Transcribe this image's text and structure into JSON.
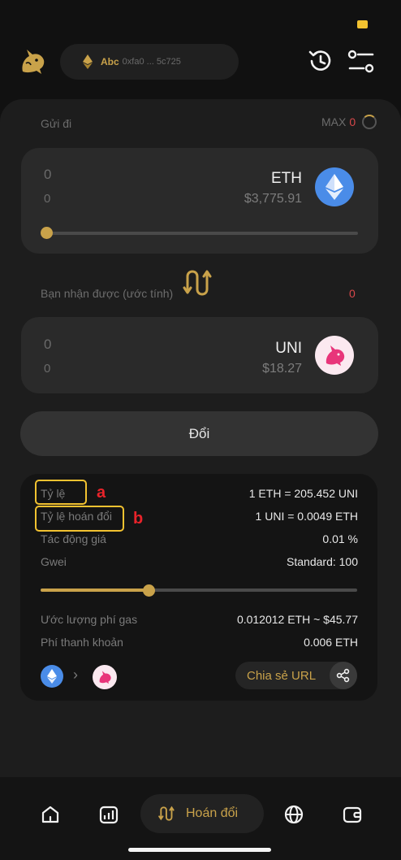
{
  "header": {
    "wallet_name": "Abc",
    "wallet_address": "0xfa0 ... 5c725"
  },
  "send": {
    "label": "Gửi đi",
    "max_label": "MAX",
    "max_value": "0",
    "amount": "0",
    "amount_usd": "0",
    "token": "ETH",
    "token_price": "$3,775.91",
    "slider_fraction": 0
  },
  "receive": {
    "label": "Bạn nhận được (ước tính)",
    "value": "0",
    "amount": "0",
    "amount_usd": "0",
    "token": "UNI",
    "token_price": "$18.27"
  },
  "swap_button": "Đổi",
  "info": {
    "rate_label": "Tỷ lệ",
    "rate_value": "1 ETH = 205.452 UNI",
    "exchange_label": "Tỷ lệ hoán đổi",
    "exchange_value": "1 UNI = 0.0049 ETH",
    "impact_label": "Tác động giá",
    "impact_value": "0.01 %",
    "gwei_label": "Gwei",
    "gwei_value": "Standard: 100",
    "gwei_slider_fraction": 0.34,
    "gas_label": "Ước lượng phí gas",
    "gas_value": "0.012012 ETH ~ $45.77",
    "liquidity_label": "Phí thanh khoản",
    "liquidity_value": "0.006 ETH",
    "share_label": "Chia sẻ URL"
  },
  "annotations": {
    "a": "a",
    "b": "b"
  },
  "nav": {
    "active_label": "Hoán đổi"
  },
  "colors": {
    "accent": "#c9a24a",
    "highlight": "#f2c230",
    "annotation": "#e8232a",
    "eth": "#4a8ce8",
    "uni_bg": "#fbe9f0",
    "uni_pink": "#e8357a"
  }
}
